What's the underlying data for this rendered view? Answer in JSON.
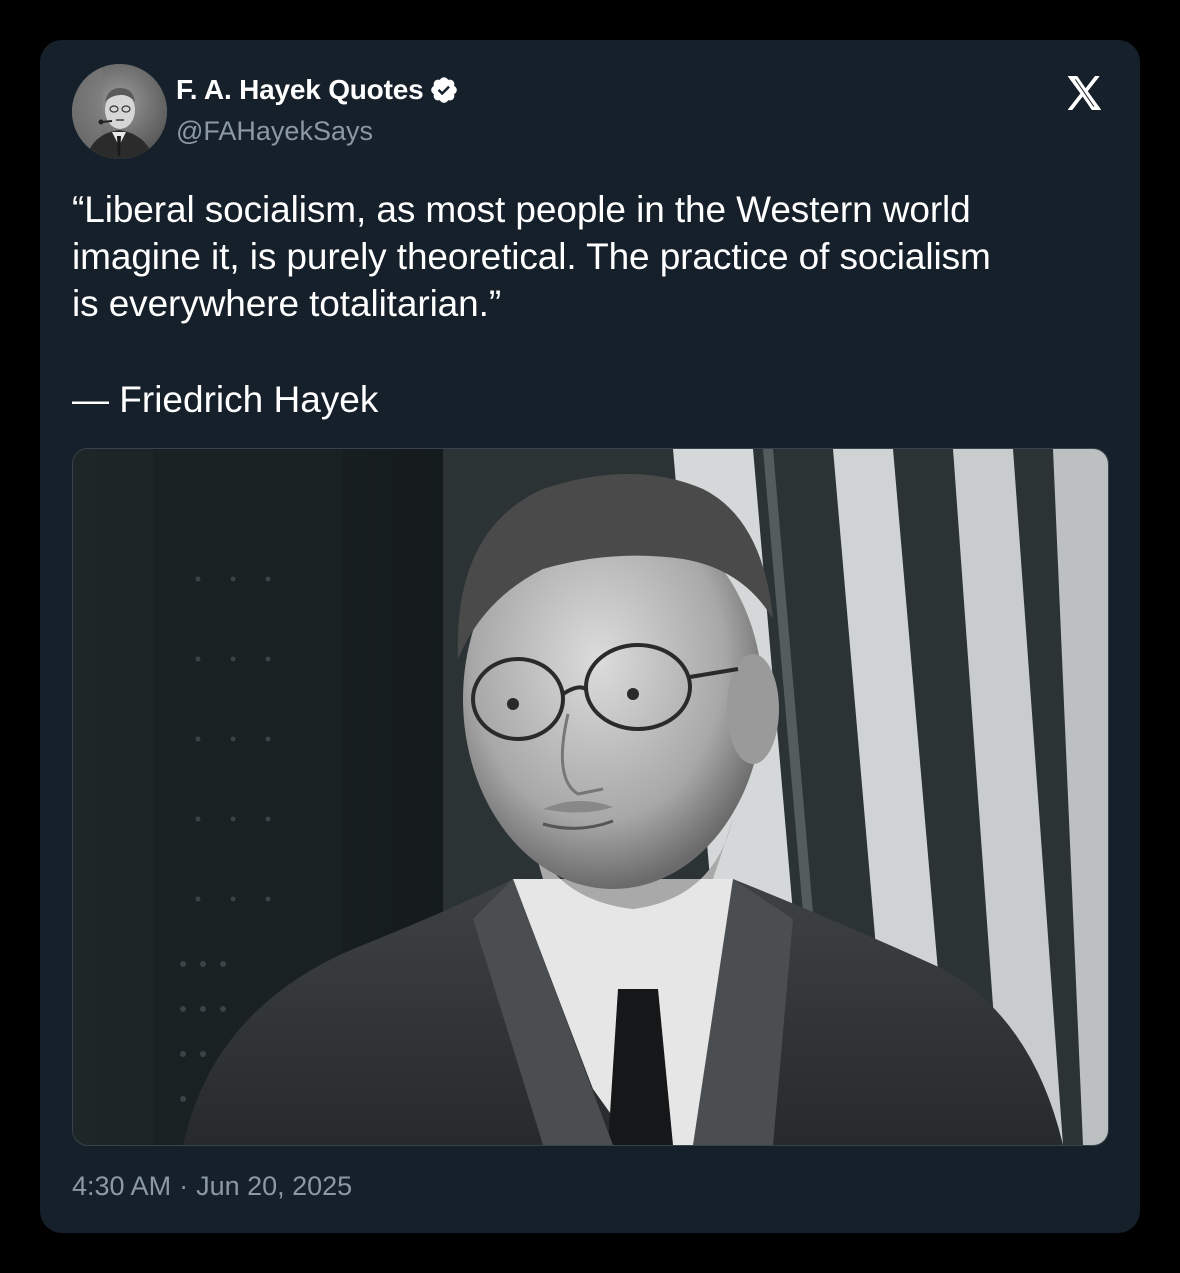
{
  "author": {
    "display_name": "F. A. Hayek Quotes",
    "handle": "@FAHayekSays",
    "verified": true,
    "avatar_icon": "portrait-avatar"
  },
  "tweet": {
    "text_lines": [
      "“Liberal socialism, as most people in the Western world",
      "imagine it, is purely theoretical. The practice of socialism",
      "is everywhere totalitarian.”"
    ],
    "attribution": "— Friedrich Hayek"
  },
  "media": {
    "type": "photo",
    "style": "black-and-white portrait"
  },
  "meta": {
    "time": "4:30 AM",
    "separator": "·",
    "date": "Jun 20, 2025"
  },
  "brand": {
    "logo_icon": "x-logo-icon"
  },
  "colors": {
    "background": "#000000",
    "card": "#16202a",
    "text_primary": "#ffffff",
    "text_secondary": "#8b98a5",
    "verified_badge": "#ffffff",
    "border": "#38444d"
  }
}
